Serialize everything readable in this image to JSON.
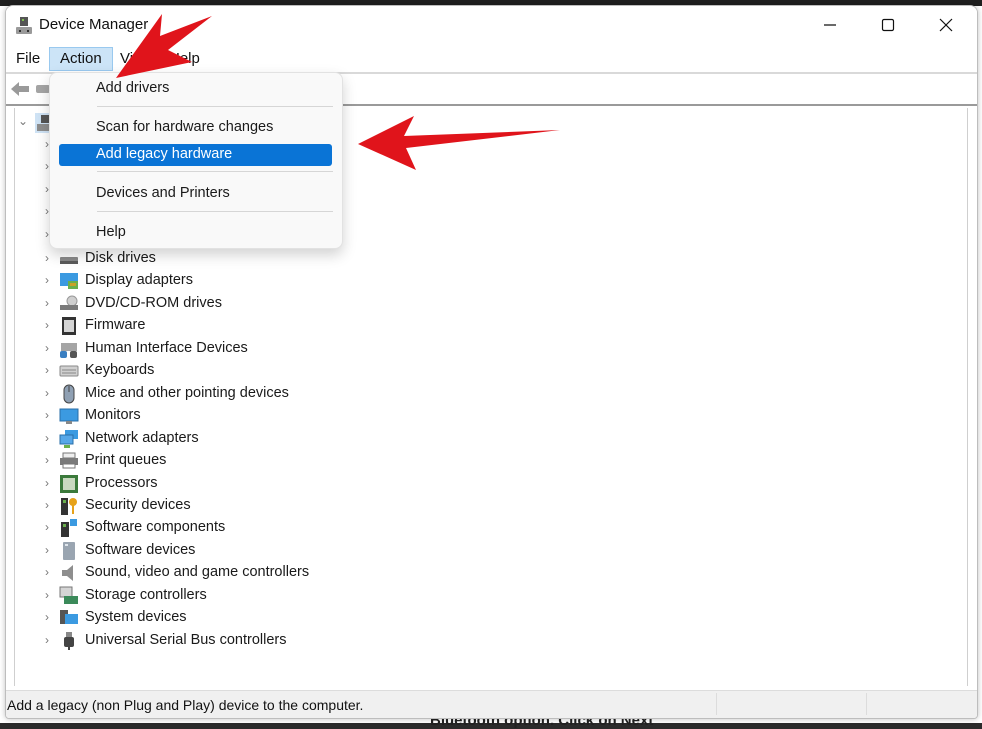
{
  "window": {
    "title": "Device Manager",
    "controls": {
      "minimize": "minimize",
      "maximize": "maximize",
      "close": "close"
    }
  },
  "menubar": {
    "items": [
      {
        "label": "File",
        "active": false
      },
      {
        "label": "Action",
        "active": true
      },
      {
        "label": "View",
        "active": false
      },
      {
        "label": "Help",
        "active": false
      }
    ]
  },
  "action_menu": {
    "items": [
      {
        "label": "Add drivers",
        "selected": false
      },
      {
        "label": "Scan for hardware changes",
        "selected": false
      },
      {
        "label": "Add legacy hardware",
        "selected": true
      },
      {
        "label": "Devices and Printers",
        "selected": false
      },
      {
        "label": "Help",
        "selected": false
      }
    ]
  },
  "tree": {
    "root": {
      "icon": "computer-icon",
      "expanded": true
    },
    "categories": [
      {
        "label": "Disk drives",
        "icon": "disk-drive-icon"
      },
      {
        "label": "Display adapters",
        "icon": "display-adapter-icon"
      },
      {
        "label": "DVD/CD-ROM drives",
        "icon": "dvd-drive-icon"
      },
      {
        "label": "Firmware",
        "icon": "firmware-chip-icon"
      },
      {
        "label": "Human Interface Devices",
        "icon": "hid-icon"
      },
      {
        "label": "Keyboards",
        "icon": "keyboard-icon"
      },
      {
        "label": "Mice and other pointing devices",
        "icon": "mouse-icon"
      },
      {
        "label": "Monitors",
        "icon": "monitor-icon"
      },
      {
        "label": "Network adapters",
        "icon": "network-adapter-icon"
      },
      {
        "label": "Print queues",
        "icon": "printer-icon"
      },
      {
        "label": "Processors",
        "icon": "processor-icon"
      },
      {
        "label": "Security devices",
        "icon": "security-key-icon"
      },
      {
        "label": "Software components",
        "icon": "software-component-icon"
      },
      {
        "label": "Software devices",
        "icon": "software-device-icon"
      },
      {
        "label": "Sound, video and game controllers",
        "icon": "speaker-icon"
      },
      {
        "label": "Storage controllers",
        "icon": "storage-controller-icon"
      },
      {
        "label": "System devices",
        "icon": "system-device-icon"
      },
      {
        "label": "Universal Serial Bus controllers",
        "icon": "usb-icon"
      }
    ]
  },
  "statusbar": {
    "text": "Add a legacy (non Plug and Play) device to the computer."
  },
  "background": {
    "bottom_text": "Bluetooth option. Click on Next"
  },
  "colors": {
    "menu_active_bg": "#cce4f7",
    "selection_blue": "#0a74d6",
    "annotation_arrow": "#e0141b"
  }
}
